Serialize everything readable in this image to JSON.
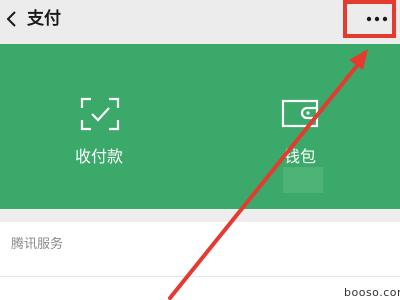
{
  "header": {
    "title": "支付",
    "back_icon": "chevron-left-icon",
    "more_icon": "more-horizontal-icon"
  },
  "actions": [
    {
      "label": "收付款",
      "icon": "scan-check-icon"
    },
    {
      "label": "钱包",
      "icon": "wallet-icon"
    }
  ],
  "section": {
    "title": "腾讯服务"
  },
  "watermark": "booso.com",
  "colors": {
    "header_bg": "#ececec",
    "panel_green": "#3aa96a",
    "annotation_red": "#e53a30",
    "page_bg": "#ededed"
  }
}
